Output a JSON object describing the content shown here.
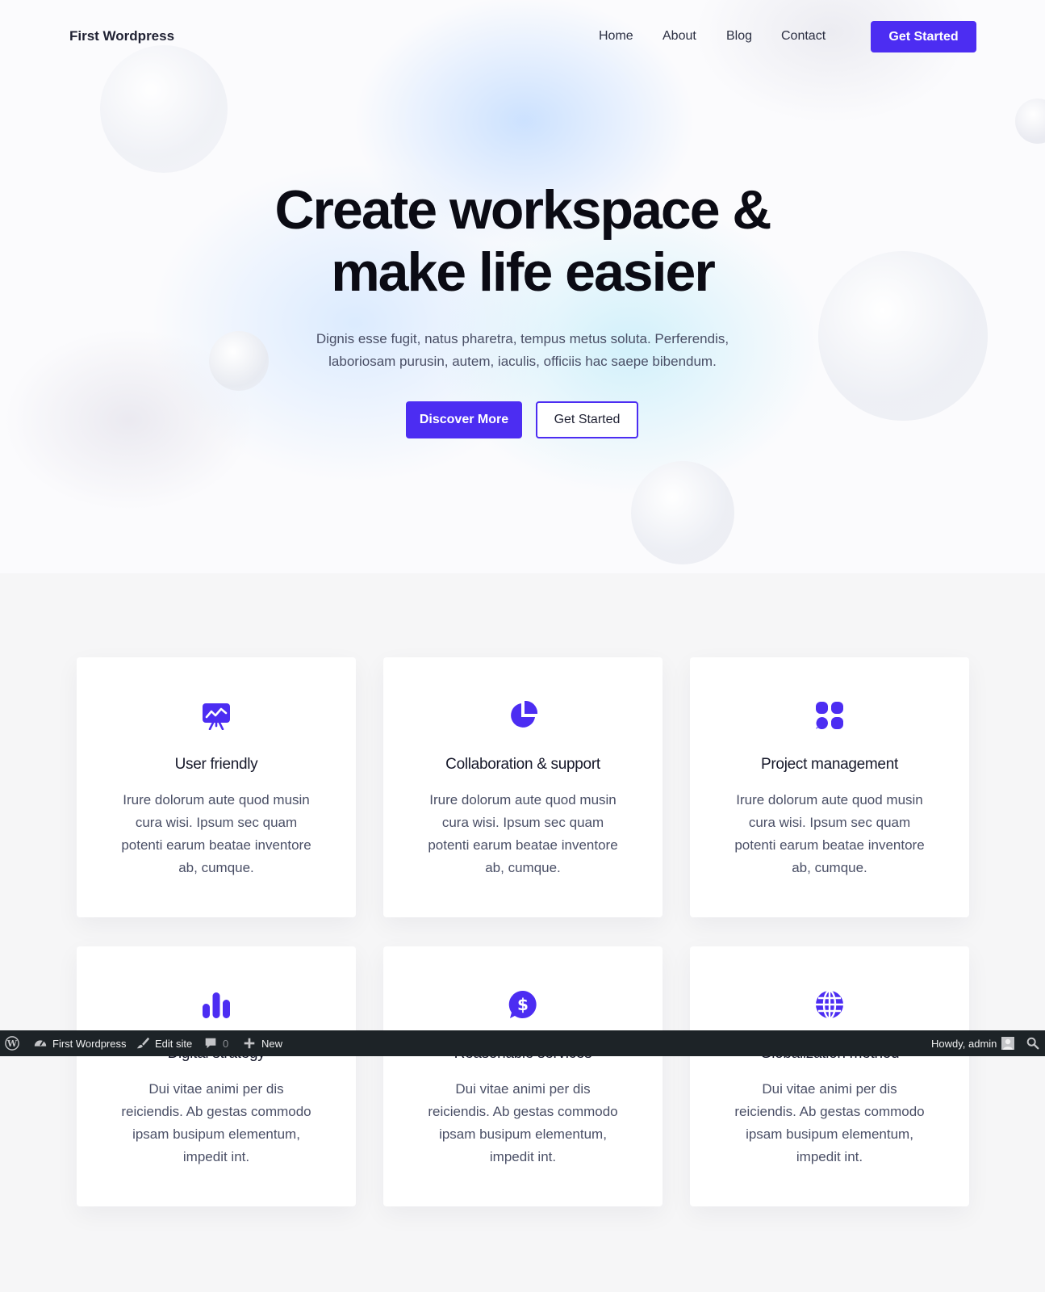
{
  "site": {
    "name": "First Wordpress"
  },
  "nav": {
    "links": [
      "Home",
      "About",
      "Blog",
      "Contact"
    ],
    "cta": "Get Started"
  },
  "hero": {
    "title_lines": [
      "Create workspace &",
      "make life easier"
    ],
    "subtitle_lines": [
      "Dignis esse fugit, natus pharetra, tempus metus soluta. Perferendis,",
      "laboriosam purusin, autem, iaculis, officiis hac saepe bibendum."
    ],
    "primary_button": "Discover More",
    "secondary_button": "Get Started"
  },
  "features": [
    {
      "icon": "presentation-chart-icon",
      "title": "User friendly",
      "text": "Irure dolorum aute quod musin cura wisi. Ipsum sec quam potenti earum beatae inventore ab, cumque."
    },
    {
      "icon": "pie-chart-icon",
      "title": "Collaboration & support",
      "text": "Irure dolorum aute quod musin cura wisi. Ipsum sec quam potenti earum beatae inventore ab, cumque."
    },
    {
      "icon": "grid-dots-icon",
      "title": "Project management",
      "text": "Irure dolorum aute quod musin cura wisi. Ipsum sec quam potenti earum beatae inventore ab, cumque."
    },
    {
      "icon": "bar-chart-icon",
      "title": "Digital strategy",
      "text": "Dui vitae animi per dis reiciendis. Ab gestas commodo ipsam busipum elementum, impedit int."
    },
    {
      "icon": "dollar-chat-icon",
      "title": "Reasonable services",
      "text": "Dui vitae animi per dis reiciendis. Ab gestas commodo ipsam busipum elementum, impedit int."
    },
    {
      "icon": "globe-icon",
      "title": "Globalization method",
      "text": "Dui vitae animi per dis reiciendis. Ab gestas commodo ipsam busipum elementum, impedit int."
    }
  ],
  "admin_bar": {
    "site_name": "First Wordpress",
    "edit_site": "Edit site",
    "comments_count": "0",
    "new": "New",
    "howdy": "Howdy, admin"
  },
  "colors": {
    "accent": "#4c2df2",
    "heading": "#0b0b14",
    "body_text": "#4a4f66",
    "admin_bar_bg": "#1d2327"
  }
}
